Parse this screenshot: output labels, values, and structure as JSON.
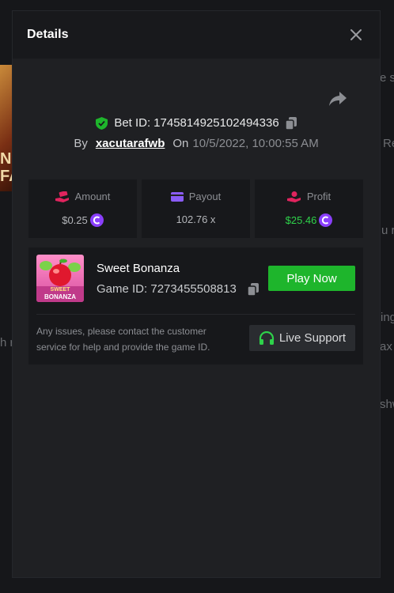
{
  "background": {
    "art_text": [
      "NI",
      "FA"
    ],
    "fragments": [
      "e s",
      "Re",
      "u r",
      "ing",
      "h r",
      "ax w",
      "shw"
    ]
  },
  "modal": {
    "title": "Details",
    "close_icon": "close-icon",
    "share_icon": "share-icon"
  },
  "bet": {
    "id_label": "Bet ID:",
    "id_value": "1745814925102494336",
    "by_label": "By",
    "username": "xacutarafwb",
    "on_label": "On",
    "datetime": "10/5/2022, 10:00:55 AM"
  },
  "stats": [
    {
      "label": "Amount",
      "value": "$0.25",
      "icon": "money-hand-icon",
      "color": "#e0245e",
      "coin": true
    },
    {
      "label": "Payout",
      "value": "102.76 x",
      "icon": "wallet-icon",
      "color": "#8a5cf6",
      "coin": false
    },
    {
      "label": "Profit",
      "value": "$25.46",
      "icon": "profit-hand-icon",
      "color": "#e0245e",
      "coin": true,
      "positive": true
    }
  ],
  "game": {
    "name": "Sweet Bonanza",
    "id_label": "Game ID:",
    "id_value": "7273455508813",
    "thumb_text": [
      "SWEET",
      "BONANZA"
    ],
    "play_label": "Play Now",
    "issue_text": "Any issues, please contact the customer service for help and provide the game ID.",
    "support_label": "Live Support"
  },
  "colors": {
    "accent_green": "#1eb52c",
    "profit_green": "#2ed24a",
    "coin_purple": "#8a3ffc",
    "shield_green": "#1eb52c"
  }
}
